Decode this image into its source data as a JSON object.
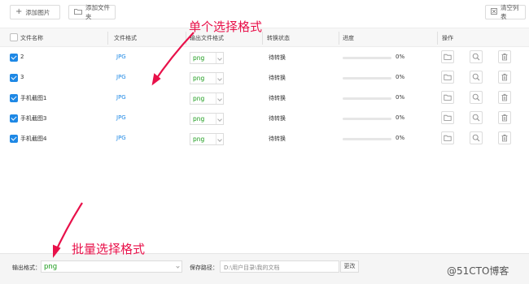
{
  "toolbar": {
    "add_image": "添加图片",
    "add_folder": "添加文件夹",
    "clear_list": "清空列表"
  },
  "table": {
    "columns": [
      "文件名称",
      "文件格式",
      "输出文件格式",
      "转换状态",
      "进度",
      "操作"
    ],
    "rows": [
      {
        "name": "2",
        "format": "JPG",
        "output": "png",
        "status": "待转换",
        "progress": 0,
        "progress_text": "0%",
        "checked": true
      },
      {
        "name": "3",
        "format": "JPG",
        "output": "png",
        "status": "待转换",
        "progress": 0,
        "progress_text": "0%",
        "checked": true
      },
      {
        "name": "手机截图1",
        "format": "JPG",
        "output": "png",
        "status": "待转换",
        "progress": 0,
        "progress_text": "0%",
        "checked": true
      },
      {
        "name": "手机截图3",
        "format": "JPG",
        "output": "png",
        "status": "待转换",
        "progress": 0,
        "progress_text": "0%",
        "checked": true
      },
      {
        "name": "手机截图4",
        "format": "JPG",
        "output": "png",
        "status": "待转换",
        "progress": 0,
        "progress_text": "0%",
        "checked": true
      }
    ],
    "actions": [
      "folder-icon",
      "search-icon",
      "trash-icon"
    ]
  },
  "bottom": {
    "output_format_label": "输出格式：",
    "output_format_value": "png",
    "save_path_label": "保存路径：",
    "save_path_value": "D:\\用户目录\\我的文档",
    "change_button": "更改"
  },
  "annotations": {
    "single": "单个选择格式",
    "batch": "批量选择格式"
  },
  "watermark": "@51CTO博客",
  "colors": {
    "accent": "#1e88e5",
    "format_value": "#1a9a1a",
    "annotation": "#e8114a"
  }
}
